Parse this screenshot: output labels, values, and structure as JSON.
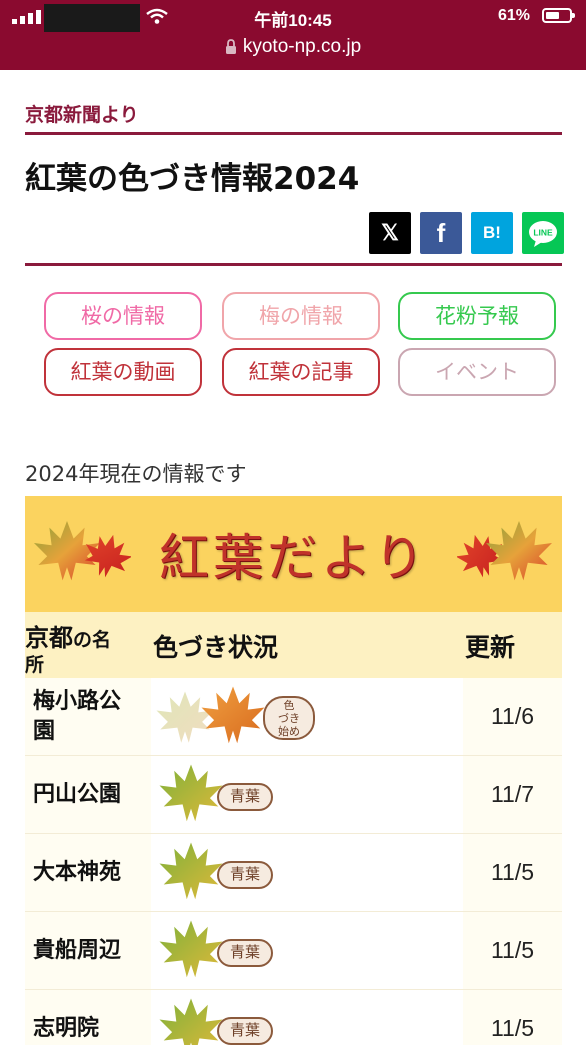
{
  "status_bar": {
    "time": "午前10:45",
    "battery": "61%",
    "battery_level": 0.61
  },
  "browser": {
    "url": "kyoto-np.co.jp"
  },
  "header": {
    "source": "京都新聞より",
    "title": "紅葉の色づき情報2024"
  },
  "share": [
    {
      "icon": "x-logo-icon",
      "label": "𝕏",
      "color": "#000000"
    },
    {
      "icon": "facebook-icon",
      "label": "f",
      "color": "#3b5998"
    },
    {
      "icon": "hatena-bookmark-icon",
      "label": "B!",
      "color": "#00a4de"
    },
    {
      "icon": "line-icon",
      "label": "LINE",
      "color": "#06c755"
    }
  ],
  "categories": [
    {
      "label": "桜の情報",
      "color": "#f06aa6"
    },
    {
      "label": "梅の情報",
      "color": "#f0a5aa"
    },
    {
      "label": "花粉予報",
      "color": "#35c94e"
    },
    {
      "label": "紅葉の動画",
      "color": "#c0323a"
    },
    {
      "label": "紅葉の記事",
      "color": "#c0323a"
    },
    {
      "label": "イベント",
      "color": "#caa6b1"
    }
  ],
  "intro": "2024年現在の情報です",
  "banner": {
    "title": "紅葉だより"
  },
  "table": {
    "headers": {
      "place_main": "京都",
      "place_small1": "の名",
      "place_small2": "所",
      "status": "色づき状況",
      "updated": "更新"
    },
    "rows": [
      {
        "name_line1": "梅小路公",
        "name_line2": "園",
        "status": "色づき始め",
        "status_parts": [
          "色",
          "づき",
          "始め"
        ],
        "date": "11/6"
      },
      {
        "name_line1": "円山公園",
        "name_line2": "",
        "status": "青葉",
        "status_parts": [
          "青葉"
        ],
        "date": "11/7"
      },
      {
        "name_line1": "大本神苑",
        "name_line2": "",
        "status": "青葉",
        "status_parts": [
          "青葉"
        ],
        "date": "11/5"
      },
      {
        "name_line1": "貴船周辺",
        "name_line2": "",
        "status": "青葉",
        "status_parts": [
          "青葉"
        ],
        "date": "11/5"
      },
      {
        "name_line1": "志明院",
        "name_line2": "",
        "status": "青葉",
        "status_parts": [
          "青葉"
        ],
        "date": "11/5"
      }
    ]
  }
}
